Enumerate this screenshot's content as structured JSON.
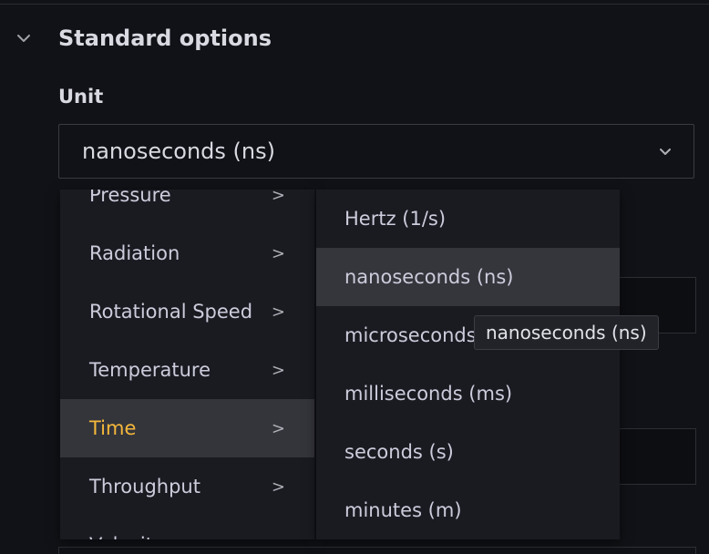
{
  "section": {
    "title": "Standard options",
    "chevron_icon": "chevron-down-icon"
  },
  "unit": {
    "label": "Unit",
    "selected_value": "nanoseconds (ns)",
    "chevron_icon": "chevron-down-icon"
  },
  "categories": {
    "items": [
      {
        "label": "Pressure",
        "arrow": ">"
      },
      {
        "label": "Radiation",
        "arrow": ">"
      },
      {
        "label": "Rotational Speed",
        "arrow": ">"
      },
      {
        "label": "Temperature",
        "arrow": ">"
      },
      {
        "label": "Time",
        "arrow": ">"
      },
      {
        "label": "Throughput",
        "arrow": ">"
      },
      {
        "label": "Velocity",
        "arrow": ">"
      }
    ],
    "active_index": 4,
    "active_color": "#f5b73b"
  },
  "time_units": {
    "items": [
      {
        "label": "Hertz (1/s)"
      },
      {
        "label": "nanoseconds (ns)"
      },
      {
        "label": "microseconds (µs)"
      },
      {
        "label": "milliseconds (ms)"
      },
      {
        "label": "seconds (s)"
      },
      {
        "label": "minutes (m)"
      }
    ],
    "hover_index": 1
  },
  "tooltip": {
    "text": "nanoseconds (ns)"
  }
}
